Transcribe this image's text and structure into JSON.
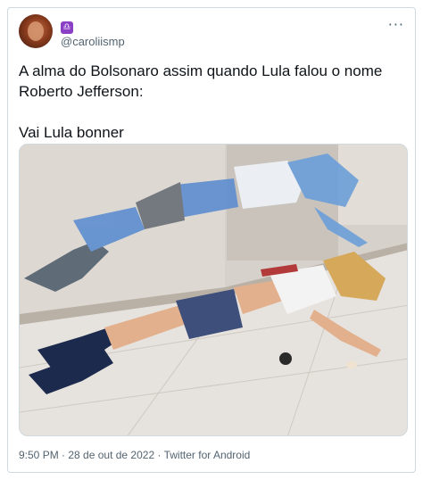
{
  "user": {
    "handle": "@caroliismp",
    "badge_glyph": "♎"
  },
  "more_glyph": "···",
  "tweet": {
    "lines": [
      "A alma do Bolsonaro assim quando Lula falou o nome Roberto Jefferson:",
      "Vai Lula bonner"
    ]
  },
  "media": {
    "colors": {
      "ghost": "#5f8fd0",
      "skirt": "#3d4f7a",
      "boots": "#1c2a4d",
      "skin": "#e3b08e",
      "hair": "#d6a85a",
      "floor": "#e6e2dd"
    }
  },
  "meta": {
    "time": "9:50 PM",
    "date": "28 de out de 2022",
    "source": "Twitter for Android",
    "separator": " · "
  }
}
